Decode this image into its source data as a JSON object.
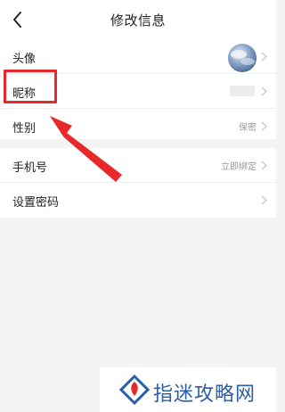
{
  "header": {
    "title": "修改信息",
    "back_icon": "chevron-left-icon"
  },
  "profile": {
    "avatar": {
      "label": "头像"
    },
    "nickname": {
      "label": "昵称"
    },
    "gender": {
      "label": "性别",
      "value": "保密"
    }
  },
  "account": {
    "phone": {
      "label": "手机号",
      "value": "立即绑定"
    },
    "password": {
      "label": "设置密码"
    }
  },
  "annotation": {
    "highlight_color": "#e8282b"
  },
  "watermark": {
    "text": "指迷攻略网",
    "color": "#2a5ea8"
  }
}
